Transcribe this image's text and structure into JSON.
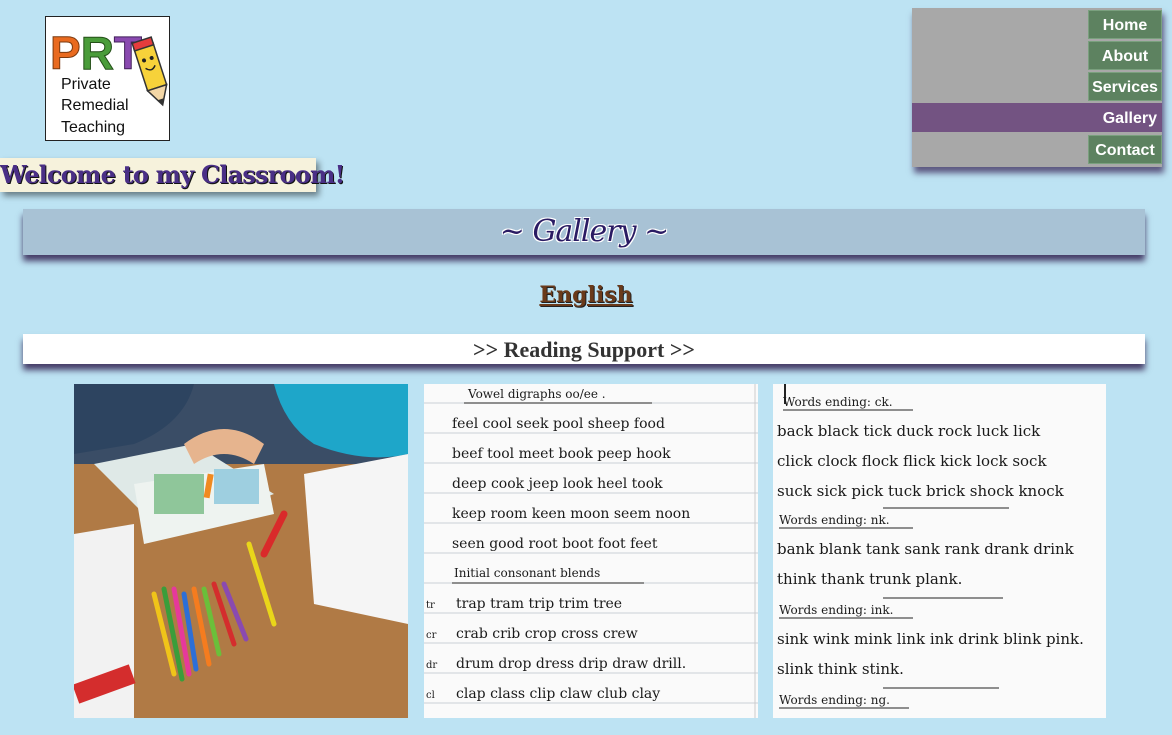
{
  "logo": {
    "letters": "PRT",
    "line1": "Private",
    "line2": "Remedial",
    "line3": "Teaching"
  },
  "welcome": "Welcome to my Classroom!",
  "nav": {
    "items": [
      {
        "label": "Home"
      },
      {
        "label": "About"
      },
      {
        "label": "Services"
      },
      {
        "label": "Gallery",
        "active": true
      },
      {
        "label": "Contact"
      }
    ]
  },
  "page": {
    "heading": "~ Gallery ~",
    "section": "English",
    "subsection": ">> Reading Support >>"
  },
  "photos": {
    "worksheet1": {
      "title": "Vowel digraphs   oo/ee .",
      "rows": [
        "feel   cool   seek  pool  sheep  food",
        "beef   tool   meet  book  peep   hook",
        "deep   cook   jeep   look   heel   took",
        "keep   room   keen   moon  seem  noon",
        "seen   good   root   boot   foot   feet"
      ],
      "subtitle": "Initial  consonant  blends",
      "blends": [
        {
          "tag": "tr",
          "words": "trap   tram   trip   trim    tree"
        },
        {
          "tag": "cr",
          "words": "crab   crib   crop   cross    crew"
        },
        {
          "tag": "dr",
          "words": "drum   drop   dress   drip   draw  drill."
        },
        {
          "tag": "cl",
          "words": "clap   class   clip   claw   club   clay"
        }
      ]
    },
    "worksheet2": {
      "sections": [
        {
          "title": "Words  ending:  ck.",
          "rows": [
            "back   black   tick   duck  rock   luck   lick",
            "click   clock   flock   flick   kick   lock  sock",
            "suck   sick   pick   tuck   brick  shock   knock"
          ]
        },
        {
          "title": "Words  ending:  nk.",
          "rows": [
            "bank   blank   tank   sank   rank  drank  drink",
            "think   thank   trunk   plank."
          ]
        },
        {
          "title": "Words  ending:  ink.",
          "rows": [
            "sink   wink   mink   link   ink   drink   blink  pink.",
            "slink   think   stink."
          ]
        },
        {
          "title": "Words  ending:  ng.",
          "rows": []
        }
      ]
    }
  },
  "colors": {
    "background": "#bde3f3",
    "nav_active": "#735382",
    "nav_item": "#5d8260"
  }
}
